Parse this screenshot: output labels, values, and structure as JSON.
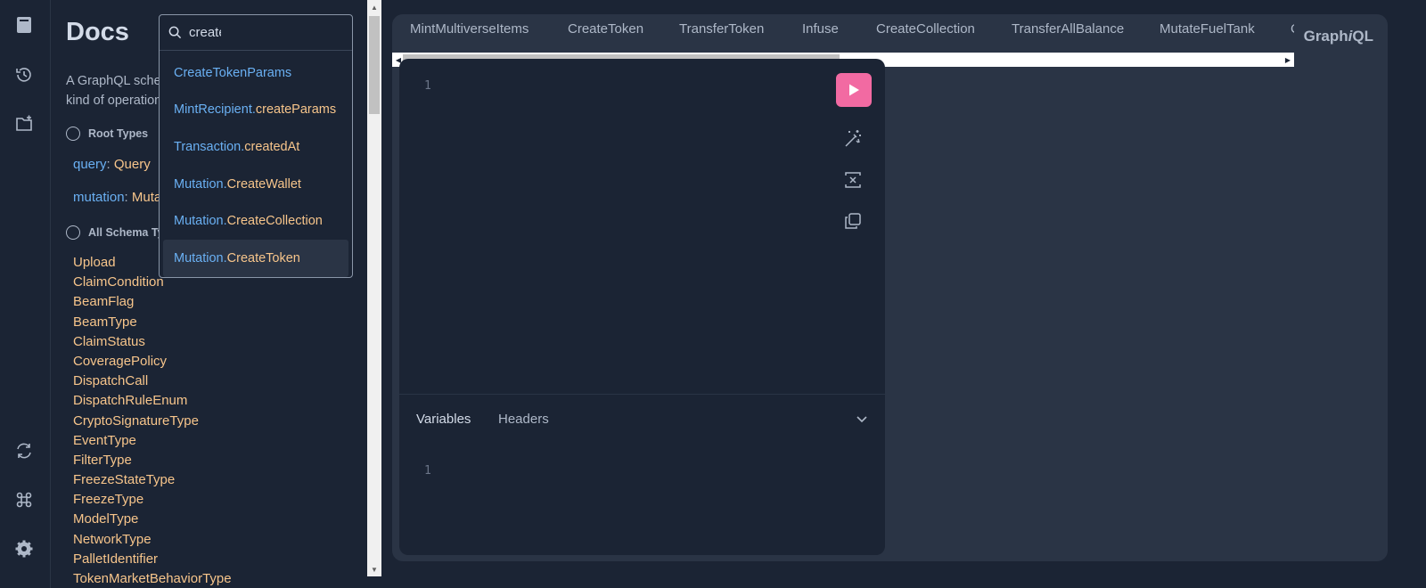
{
  "rail": {
    "top_icons": [
      "docs-icon",
      "history-icon",
      "folder-icon"
    ],
    "bottom_icons": [
      "refresh-icon",
      "keyboard-shortcut-icon",
      "settings-icon"
    ]
  },
  "docs": {
    "title": "Docs",
    "desc_line1": "A GraphQL sche",
    "desc_line2": "kind of operation",
    "root_types_label": "Root Types",
    "root_query_field": "query",
    "root_query_type": "Query",
    "root_mutation_field": "mutation",
    "root_mutation_type": "Mutat",
    "all_types_label": "All Schema Typ",
    "types": [
      "Upload",
      "ClaimCondition",
      "BeamFlag",
      "BeamType",
      "ClaimStatus",
      "CoveragePolicy",
      "DispatchCall",
      "DispatchRuleEnum",
      "CryptoSignatureType",
      "EventType",
      "FilterType",
      "FreezeStateType",
      "FreezeType",
      "ModelType",
      "NetworkType",
      "PalletIdentifier",
      "TokenMarketBehaviorType"
    ]
  },
  "search": {
    "value": "create",
    "results": [
      {
        "prefix": "",
        "name": "CreateTokenParams",
        "whole_blue": true
      },
      {
        "prefix": "MintRecipient.",
        "name": "createParams"
      },
      {
        "prefix": "Transaction.",
        "name": "createdAt"
      },
      {
        "prefix": "Mutation.",
        "name": "CreateWallet"
      },
      {
        "prefix": "Mutation.",
        "name": "CreateCollection"
      },
      {
        "prefix": "Mutation.",
        "name": "CreateToken",
        "active": true
      }
    ]
  },
  "tabs": [
    "MintMultiverseItems",
    "CreateToken",
    "TransferToken",
    "Infuse",
    "CreateCollection",
    "TransferAllBalance",
    "MutateFuelTank",
    "C"
  ],
  "brand": {
    "graph": "Graph",
    "i": "i",
    "ql": "QL"
  },
  "editor": {
    "query_line": "1",
    "var_line": "1",
    "variables_tab": "Variables",
    "headers_tab": "Headers",
    "run_color": "#f26aa2"
  }
}
